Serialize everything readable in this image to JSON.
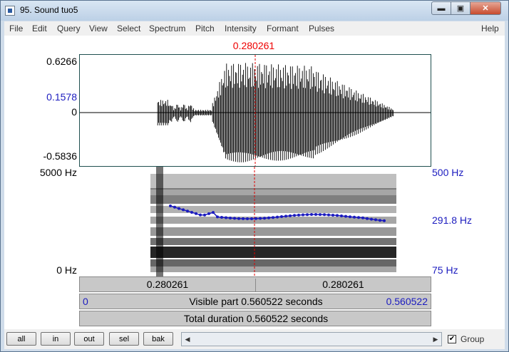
{
  "window": {
    "title": "95. Sound tuo5",
    "min_glyph": "▬",
    "max_glyph": "▣",
    "close_glyph": "✕"
  },
  "menu": [
    "File",
    "Edit",
    "Query",
    "View",
    "Select",
    "Spectrum",
    "Pitch",
    "Intensity",
    "Formant",
    "Pulses",
    "Help"
  ],
  "cursor": {
    "time_label": "0.280261"
  },
  "waveform": {
    "max_label": "0.6266",
    "cursor_value_label": "0.1578",
    "zero_label": "0",
    "min_label": "-0.5836"
  },
  "spectrogram": {
    "freq_max_label": "5000 Hz",
    "freq_min_label": "0 Hz"
  },
  "pitch": {
    "max_label": "500 Hz",
    "value_label": "291.8 Hz",
    "min_label": "75 Hz",
    "color": "#1b1bbf"
  },
  "bars": {
    "left_time": "0.280261",
    "right_time": "0.280261",
    "visible_start": "0",
    "visible_text": "Visible part 0.560522 seconds",
    "visible_end": "0.560522",
    "total_text": "Total duration 0.560522 seconds"
  },
  "buttons": [
    "all",
    "in",
    "out",
    "sel",
    "bak"
  ],
  "scroll": {
    "left_arrow": "◀",
    "right_arrow": "▶"
  },
  "group": {
    "label": "Group",
    "checked_glyph": "✔"
  },
  "colors": {
    "cursor": "#e00000",
    "pitch_track": "#1b1bbf",
    "waveform": "#000000"
  }
}
